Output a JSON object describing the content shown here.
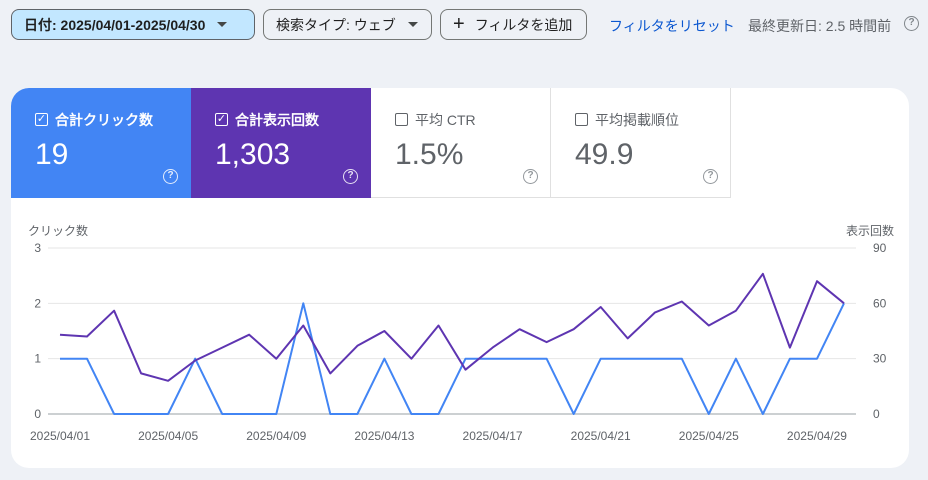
{
  "filters": {
    "date_label": "日付: 2025/04/01-2025/04/30",
    "search_type_label": "検索タイプ: ウェブ",
    "add_filter_label": "フィルタを追加",
    "reset_link": "フィルタをリセット",
    "last_updated": "最終更新日: 2.5 時間前"
  },
  "metrics": [
    {
      "label": "合計クリック数",
      "value": "19",
      "checked": true,
      "color": "#4285f4"
    },
    {
      "label": "合計表示回数",
      "value": "1,303",
      "checked": true,
      "color": "#5e35b1"
    },
    {
      "label": "平均 CTR",
      "value": "1.5%",
      "checked": false
    },
    {
      "label": "平均掲載順位",
      "value": "49.9",
      "checked": false
    }
  ],
  "chart_data": {
    "type": "line",
    "left_axis_label": "クリック数",
    "right_axis_label": "表示回数",
    "left_ylim": [
      0,
      3
    ],
    "right_ylim": [
      0,
      90
    ],
    "left_ticks": [
      "0",
      "1",
      "2",
      "3"
    ],
    "right_ticks": [
      "0",
      "30",
      "60",
      "90"
    ],
    "x": [
      "2025/04/01",
      "2025/04/02",
      "2025/04/03",
      "2025/04/04",
      "2025/04/05",
      "2025/04/06",
      "2025/04/07",
      "2025/04/08",
      "2025/04/09",
      "2025/04/10",
      "2025/04/11",
      "2025/04/12",
      "2025/04/13",
      "2025/04/14",
      "2025/04/15",
      "2025/04/16",
      "2025/04/17",
      "2025/04/18",
      "2025/04/19",
      "2025/04/20",
      "2025/04/21",
      "2025/04/22",
      "2025/04/23",
      "2025/04/24",
      "2025/04/25",
      "2025/04/26",
      "2025/04/27",
      "2025/04/28",
      "2025/04/29",
      "2025/04/30"
    ],
    "x_tick_labels": [
      "2025/04/01",
      "2025/04/05",
      "2025/04/09",
      "2025/04/13",
      "2025/04/17",
      "2025/04/21",
      "2025/04/25",
      "2025/04/29"
    ],
    "x_tick_indices": [
      0,
      4,
      8,
      12,
      16,
      20,
      24,
      28
    ],
    "grid": true,
    "series": [
      {
        "axis": "left",
        "color": "#4285f4",
        "values": [
          1,
          1,
          0,
          0,
          0,
          1,
          0,
          0,
          0,
          2,
          0,
          0,
          1,
          0,
          0,
          1,
          1,
          1,
          1,
          0,
          1,
          1,
          1,
          1,
          0,
          1,
          0,
          1,
          1,
          2
        ]
      },
      {
        "axis": "right",
        "color": "#5e35b1",
        "values": [
          43,
          42,
          56,
          22,
          18,
          29,
          36,
          43,
          30,
          48,
          22,
          37,
          45,
          30,
          48,
          24,
          36,
          46,
          39,
          46,
          58,
          41,
          55,
          61,
          48,
          56,
          76,
          36,
          72,
          60
        ]
      }
    ]
  }
}
